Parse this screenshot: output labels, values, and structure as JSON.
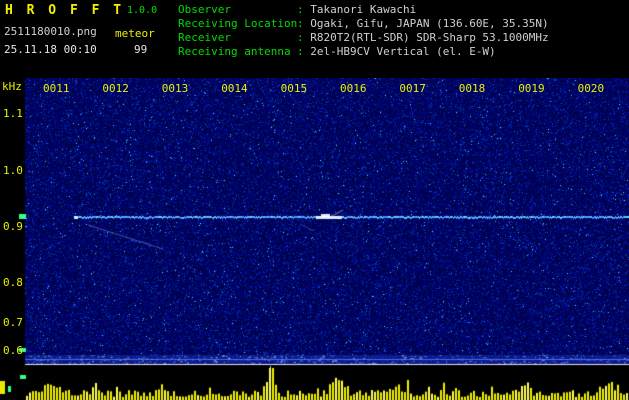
{
  "app": {
    "title": "H R O F F T",
    "version": "1.0.0",
    "filename": "2511180010.png",
    "mode": "meteor",
    "datetime": "25.11.18 00:10",
    "count": "99"
  },
  "info_rows": [
    {
      "label": "Observer",
      "value": "Takanori Kawachi"
    },
    {
      "label": "Receiving Location",
      "value": "Ogaki, Gifu, JAPAN (136.60E, 35.35N)"
    },
    {
      "label": "Receiver",
      "value": "R820T2(RTL-SDR) SDR-Sharp 53.1000MHz"
    },
    {
      "label": "Receiving antenna",
      "value": "2el-HB9CV Vertical (el. E-W)"
    }
  ],
  "spectrogram": {
    "freq_axis_unit": "kHz",
    "freq_labels": [
      "1.1",
      "1.0",
      "0.9",
      "0.8",
      "0.7",
      "0.6"
    ],
    "time_labels": [
      "0011",
      "0012",
      "0013",
      "0014",
      "0015",
      "0016",
      "0017",
      "0018",
      "0019",
      "0020"
    ],
    "carrier_frequency_khz": 0.92,
    "description": "10-minute meteor-echo spectrogram with continuous carrier line near 0.92 kHz, faint meteor echo near 0015, and signal-level bar graph at bottom"
  },
  "colors": {
    "background": "#000000",
    "title": "#f0f000",
    "version": "#00e000",
    "filename": "#d0d0d0",
    "mode": "#f0f000",
    "datetime": "#e6e6e6",
    "header_label": "#00dc00",
    "header_value": "#d0d0d0",
    "axis_labels": "#e8f000",
    "noise_base": "#000050",
    "carrier": "#9fdcff",
    "echo": "#ffffff",
    "separator": "#dde0f2",
    "bars": "#f0f000",
    "marker_green": "#35ff8d"
  }
}
